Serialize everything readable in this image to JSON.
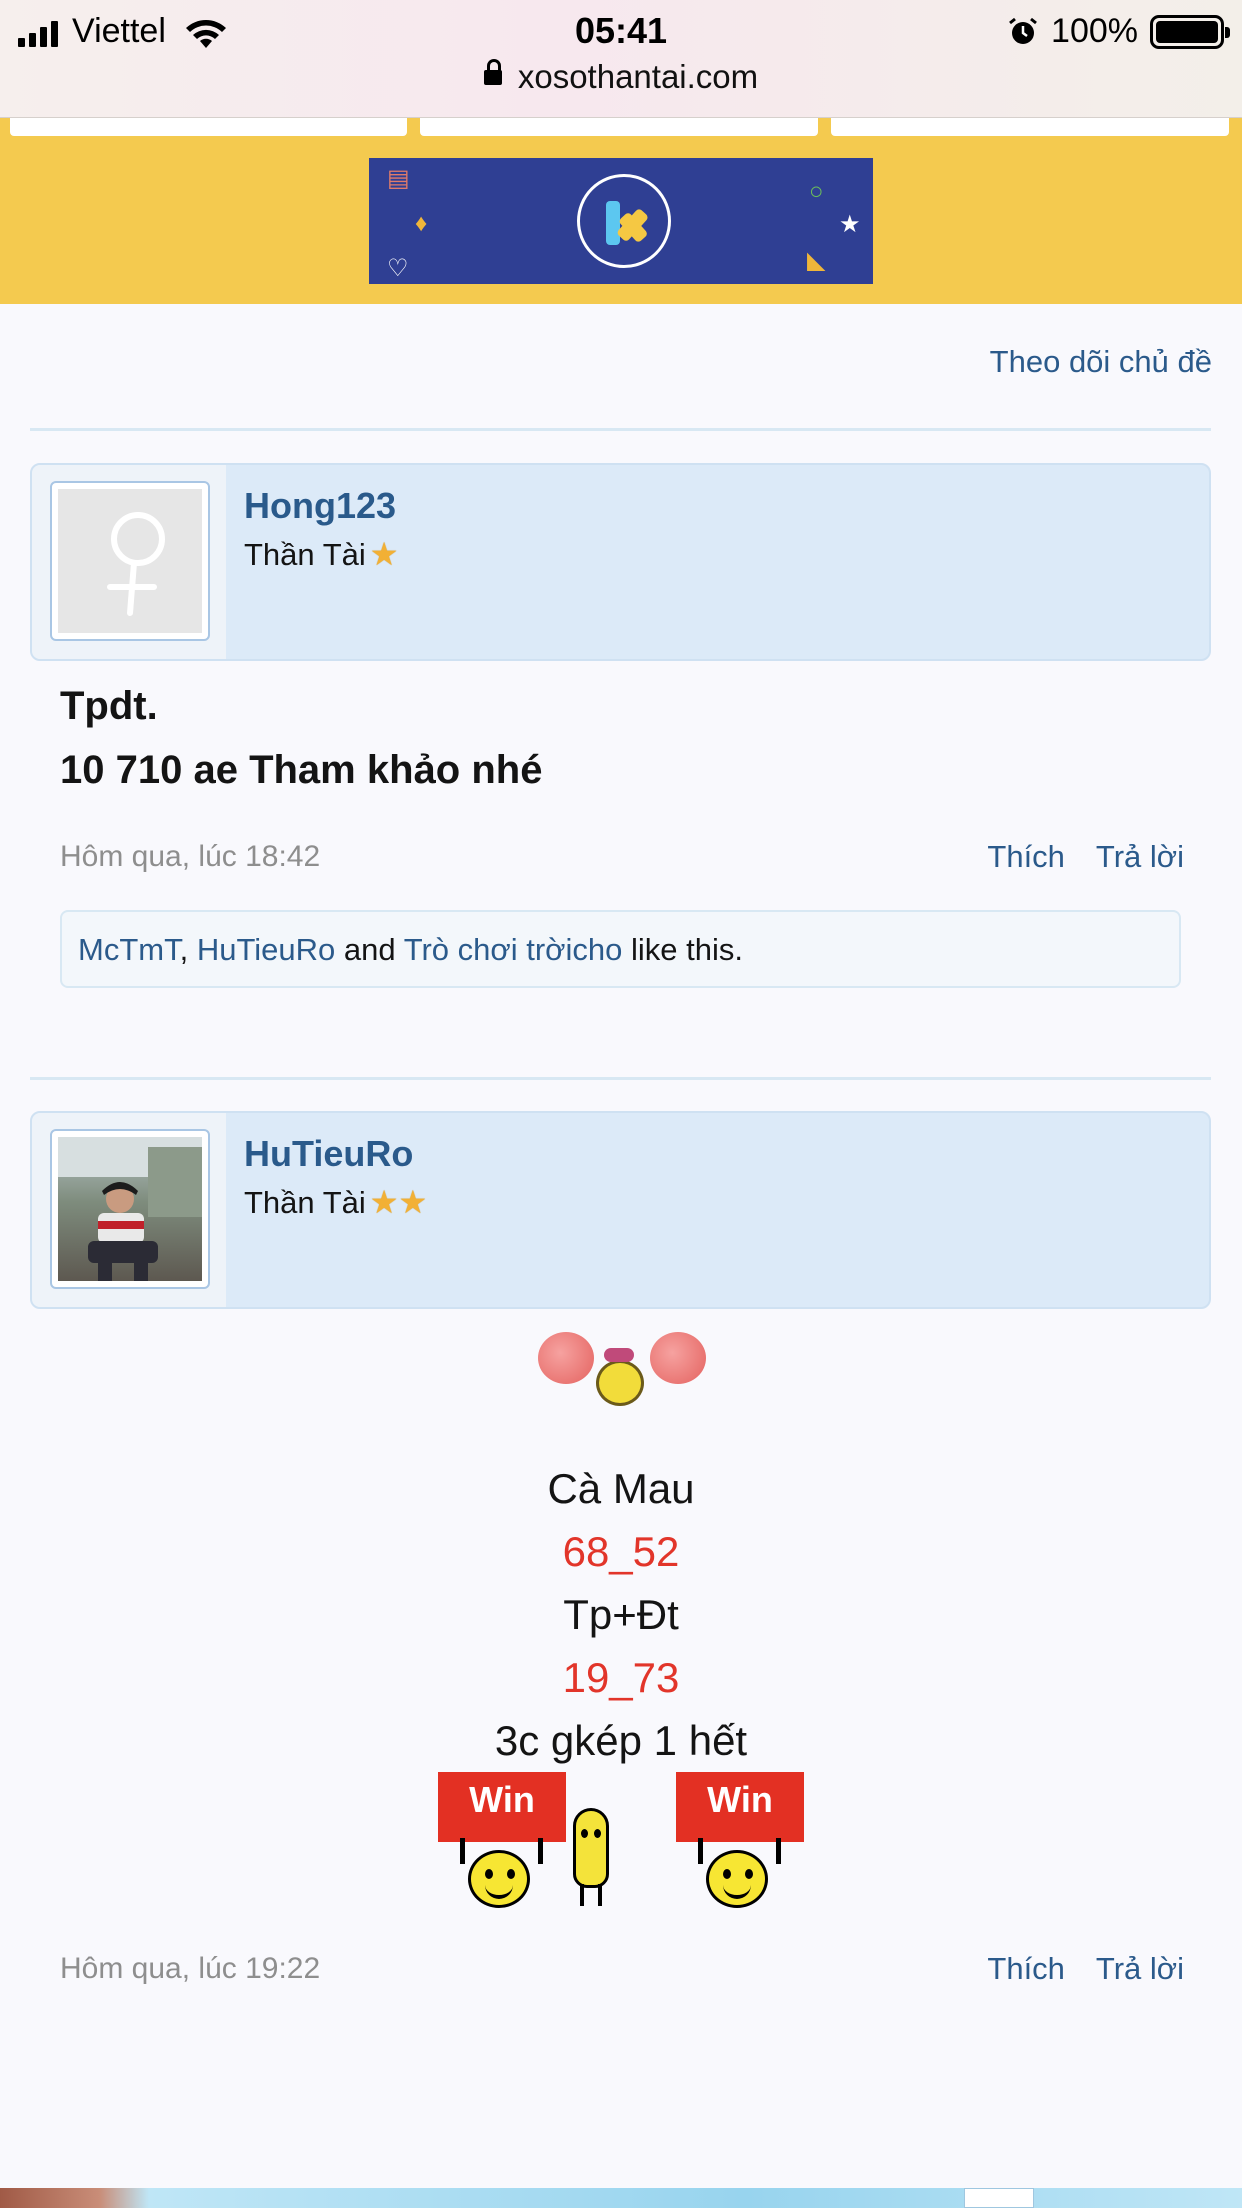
{
  "status_bar": {
    "carrier": "Viettel",
    "time": "05:41",
    "battery": "100%"
  },
  "url_bar": {
    "domain": "xosothantai.com"
  },
  "thread": {
    "follow_label": "Theo dõi chủ đề"
  },
  "posts": [
    {
      "username": "Hong123",
      "rank": "Thần Tài",
      "stars": "★",
      "message_lines": [
        "Tpdt.",
        "10 710 ae Tham khảo nhé"
      ],
      "timestamp": "Hôm qua, lúc 18:42",
      "like_label": "Thích",
      "reply_label": "Trả lời",
      "likes": {
        "users": [
          "McTmT",
          "HuTieuRo",
          "Trò chơi trờicho"
        ],
        "sep_comma": ",",
        "sep_and": "and",
        "suffix": "like this."
      }
    },
    {
      "username": "HuTieuRo",
      "rank": "Thần Tài",
      "stars": "★★",
      "message_lines": [
        {
          "text": "Cà Mau",
          "color": "#141414"
        },
        {
          "text": "68_52",
          "color": "#e2352a"
        },
        {
          "text": "Tp+Đt",
          "color": "#141414"
        },
        {
          "text": "19_73",
          "color": "#e2352a"
        },
        {
          "text": "3c gkép 1 hết",
          "color": "#141414"
        }
      ],
      "win_sign": "Win",
      "timestamp": "Hôm qua, lúc 19:22",
      "like_label": "Thích",
      "reply_label": "Trả lời"
    }
  ],
  "colors": {
    "link": "#2b5a8b",
    "header_bg": "#dceaf8",
    "yellow_ad": "#f4ca4f",
    "number_red": "#e2352a"
  }
}
